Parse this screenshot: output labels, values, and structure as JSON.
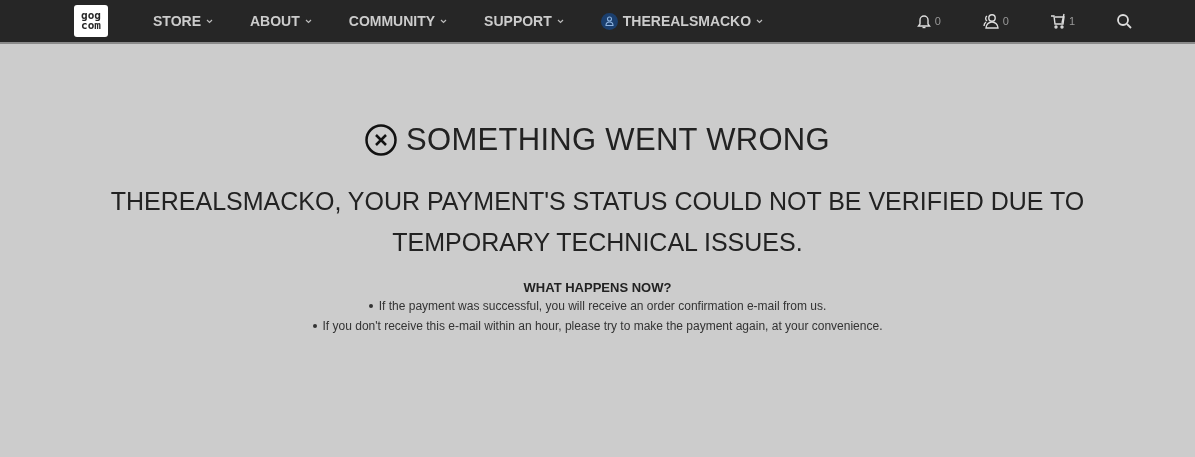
{
  "header": {
    "logo": [
      "gog",
      "com"
    ],
    "nav": [
      {
        "label": "STORE",
        "kind": "menu"
      },
      {
        "label": "ABOUT",
        "kind": "menu"
      },
      {
        "label": "COMMUNITY",
        "kind": "menu"
      },
      {
        "label": "SUPPORT",
        "kind": "menu"
      },
      {
        "label": "THEREALSMACKO",
        "kind": "user"
      }
    ],
    "actions": [
      {
        "kind": "bell",
        "count": "0"
      },
      {
        "kind": "friends",
        "count": "0"
      },
      {
        "kind": "cart",
        "count": "1"
      },
      {
        "kind": "search"
      }
    ]
  },
  "error": {
    "title": "SOMETHING WENT WRONG",
    "message": "THEREALSMACKO, YOUR PAYMENT'S STATUS COULD NOT BE VERIFIED DUE TO TEMPORARY TECHNICAL ISSUES.",
    "subheading": "WHAT HAPPENS NOW?",
    "items": [
      "If the payment was successful, you will receive an order confirmation e-mail from us.",
      "If you don't receive this e-mail within an hour, please try to make the payment again, at your convenience."
    ]
  }
}
